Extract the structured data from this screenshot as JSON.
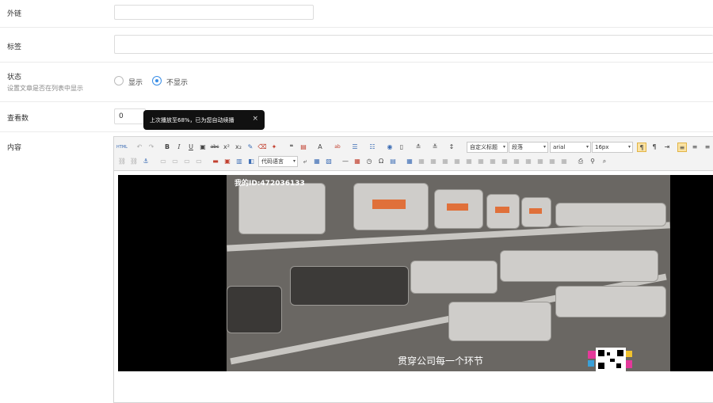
{
  "form": {
    "external_link": {
      "label": "外链",
      "value": ""
    },
    "tags": {
      "label": "标签",
      "value": ""
    },
    "status": {
      "label": "状态",
      "hint": "设置文章是否在列表中显示",
      "options": [
        {
          "label": "显示",
          "selected": false
        },
        {
          "label": "不显示",
          "selected": true
        }
      ]
    },
    "views": {
      "label": "查看数",
      "value": "0"
    },
    "content": {
      "label": "内容"
    }
  },
  "tooltip": {
    "text": "上次播放至68%，已为您自动续播",
    "close": "×"
  },
  "toolbar": {
    "html_button": "HTML",
    "font_button": "A",
    "highlight_button": "ab",
    "code_select": "代码语言",
    "title_select": "自定义标题",
    "paragraph_select": "段落",
    "font_family_select": "arial",
    "font_size_select": "16px"
  },
  "video": {
    "watermark": "我的ID:472036133",
    "subtitle": "贯穿公司每一个环节"
  }
}
